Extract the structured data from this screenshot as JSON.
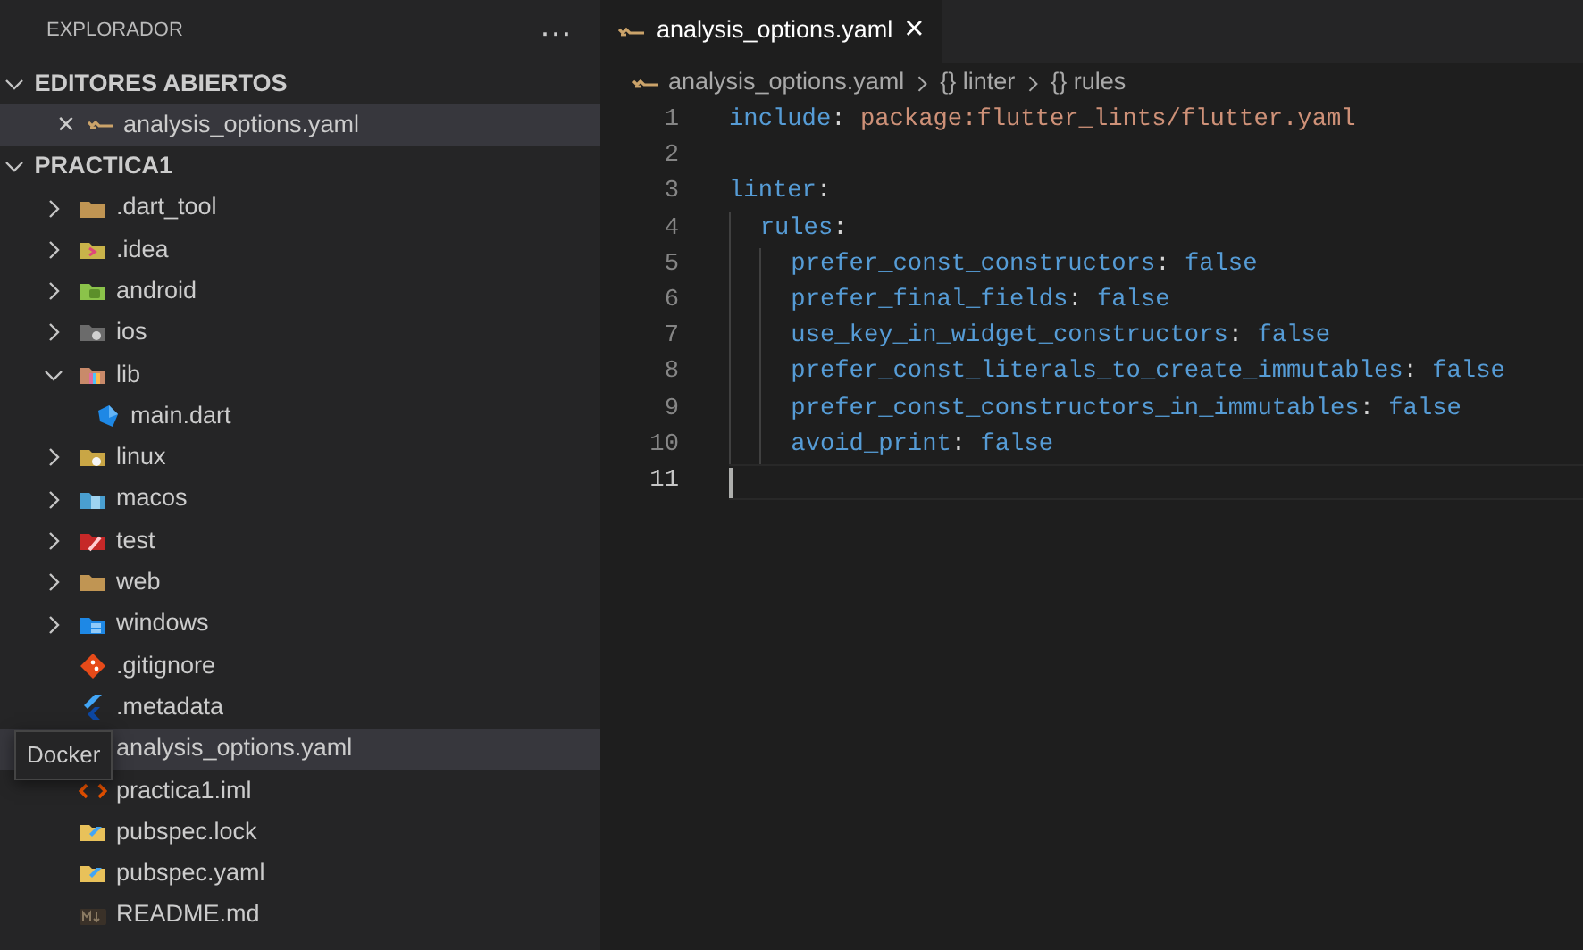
{
  "explorer": {
    "title": "EXPLORADOR",
    "more": "···"
  },
  "open_editors": {
    "title": "EDITORES ABIERTOS",
    "expanded": true,
    "items": [
      {
        "close": "×",
        "label": "analysis_options.yaml",
        "selected": true
      }
    ]
  },
  "project": {
    "title": "PRACTICA1",
    "expanded": true,
    "items": [
      {
        "label": ".dart_tool",
        "kind": "folder",
        "expanded": false,
        "selected": false
      },
      {
        "label": ".idea",
        "kind": "folder",
        "expanded": false,
        "selected": false
      },
      {
        "label": "android",
        "kind": "folder",
        "expanded": false,
        "selected": false
      },
      {
        "label": "ios",
        "kind": "folder",
        "expanded": false,
        "selected": false
      },
      {
        "label": "lib",
        "kind": "folder",
        "expanded": true,
        "selected": false,
        "children": [
          {
            "label": "main.dart",
            "kind": "file",
            "selected": false
          }
        ]
      },
      {
        "label": "linux",
        "kind": "folder",
        "expanded": false,
        "selected": false
      },
      {
        "label": "macos",
        "kind": "folder",
        "expanded": false,
        "selected": false
      },
      {
        "label": "test",
        "kind": "folder",
        "expanded": false,
        "selected": false
      },
      {
        "label": "web",
        "kind": "folder",
        "expanded": false,
        "selected": false
      },
      {
        "label": "windows",
        "kind": "folder",
        "expanded": false,
        "selected": false
      },
      {
        "label": ".gitignore",
        "kind": "file",
        "selected": false
      },
      {
        "label": ".metadata",
        "kind": "file",
        "selected": false
      },
      {
        "label": "analysis_options.yaml",
        "kind": "file",
        "selected": true
      },
      {
        "label": "practica1.iml",
        "kind": "file",
        "selected": false
      },
      {
        "label": "pubspec.lock",
        "kind": "file",
        "selected": false
      },
      {
        "label": "pubspec.yaml",
        "kind": "file",
        "selected": false
      },
      {
        "label": "README.md",
        "kind": "file",
        "selected": false
      }
    ]
  },
  "tooltip": {
    "text": "Docker"
  },
  "tabs": [
    {
      "label": "analysis_options.yaml",
      "close": "×",
      "selected": true
    }
  ],
  "breadcrumb": [
    {
      "label": "analysis_options.yaml",
      "kind": "file"
    },
    {
      "label": "linter",
      "kind": "symbol",
      "symbol": "{}"
    },
    {
      "label": "rules",
      "kind": "symbol",
      "symbol": "{}"
    }
  ],
  "editor": {
    "lines": [
      {
        "number": "1",
        "active": false,
        "tokens": [
          {
            "text": "include",
            "kind": "key"
          },
          {
            "text": ": ",
            "kind": "punct"
          },
          {
            "text": "package:flutter_lints/flutter.yaml",
            "kind": "string"
          }
        ]
      },
      {
        "number": "2",
        "active": false
      },
      {
        "number": "3",
        "active": false,
        "tokens": [
          {
            "text": "linter",
            "kind": "key"
          },
          {
            "text": ":",
            "kind": "punct"
          }
        ]
      },
      {
        "number": "4",
        "active": false,
        "tokens": [
          {
            "text": "  rules",
            "kind": "key"
          },
          {
            "text": ":",
            "kind": "punct"
          }
        ]
      },
      {
        "number": "5",
        "active": false,
        "tokens": [
          {
            "text": "    prefer_const_constructors",
            "kind": "key"
          },
          {
            "text": ": ",
            "kind": "punct"
          },
          {
            "text": "false",
            "kind": "bool"
          }
        ]
      },
      {
        "number": "6",
        "active": false,
        "tokens": [
          {
            "text": "    prefer_final_fields",
            "kind": "key"
          },
          {
            "text": ": ",
            "kind": "punct"
          },
          {
            "text": "false",
            "kind": "bool"
          }
        ]
      },
      {
        "number": "7",
        "active": false,
        "tokens": [
          {
            "text": "    use_key_in_widget_constructors",
            "kind": "key"
          },
          {
            "text": ": ",
            "kind": "punct"
          },
          {
            "text": "false",
            "kind": "bool"
          }
        ]
      },
      {
        "number": "8",
        "active": false,
        "tokens": [
          {
            "text": "    prefer_const_literals_to_create_immutables",
            "kind": "key"
          },
          {
            "text": ": ",
            "kind": "punct"
          },
          {
            "text": "false",
            "kind": "bool"
          }
        ]
      },
      {
        "number": "9",
        "active": false,
        "tokens": [
          {
            "text": "    prefer_const_constructors_in_immutables",
            "kind": "key"
          },
          {
            "text": ": ",
            "kind": "punct"
          },
          {
            "text": "false",
            "kind": "bool"
          }
        ]
      },
      {
        "number": "10",
        "active": false,
        "tokens": [
          {
            "text": "    avoid_print",
            "kind": "key"
          },
          {
            "text": ": ",
            "kind": "punct"
          },
          {
            "text": "false",
            "kind": "bool"
          }
        ]
      },
      {
        "number": "11",
        "active": true
      }
    ]
  }
}
